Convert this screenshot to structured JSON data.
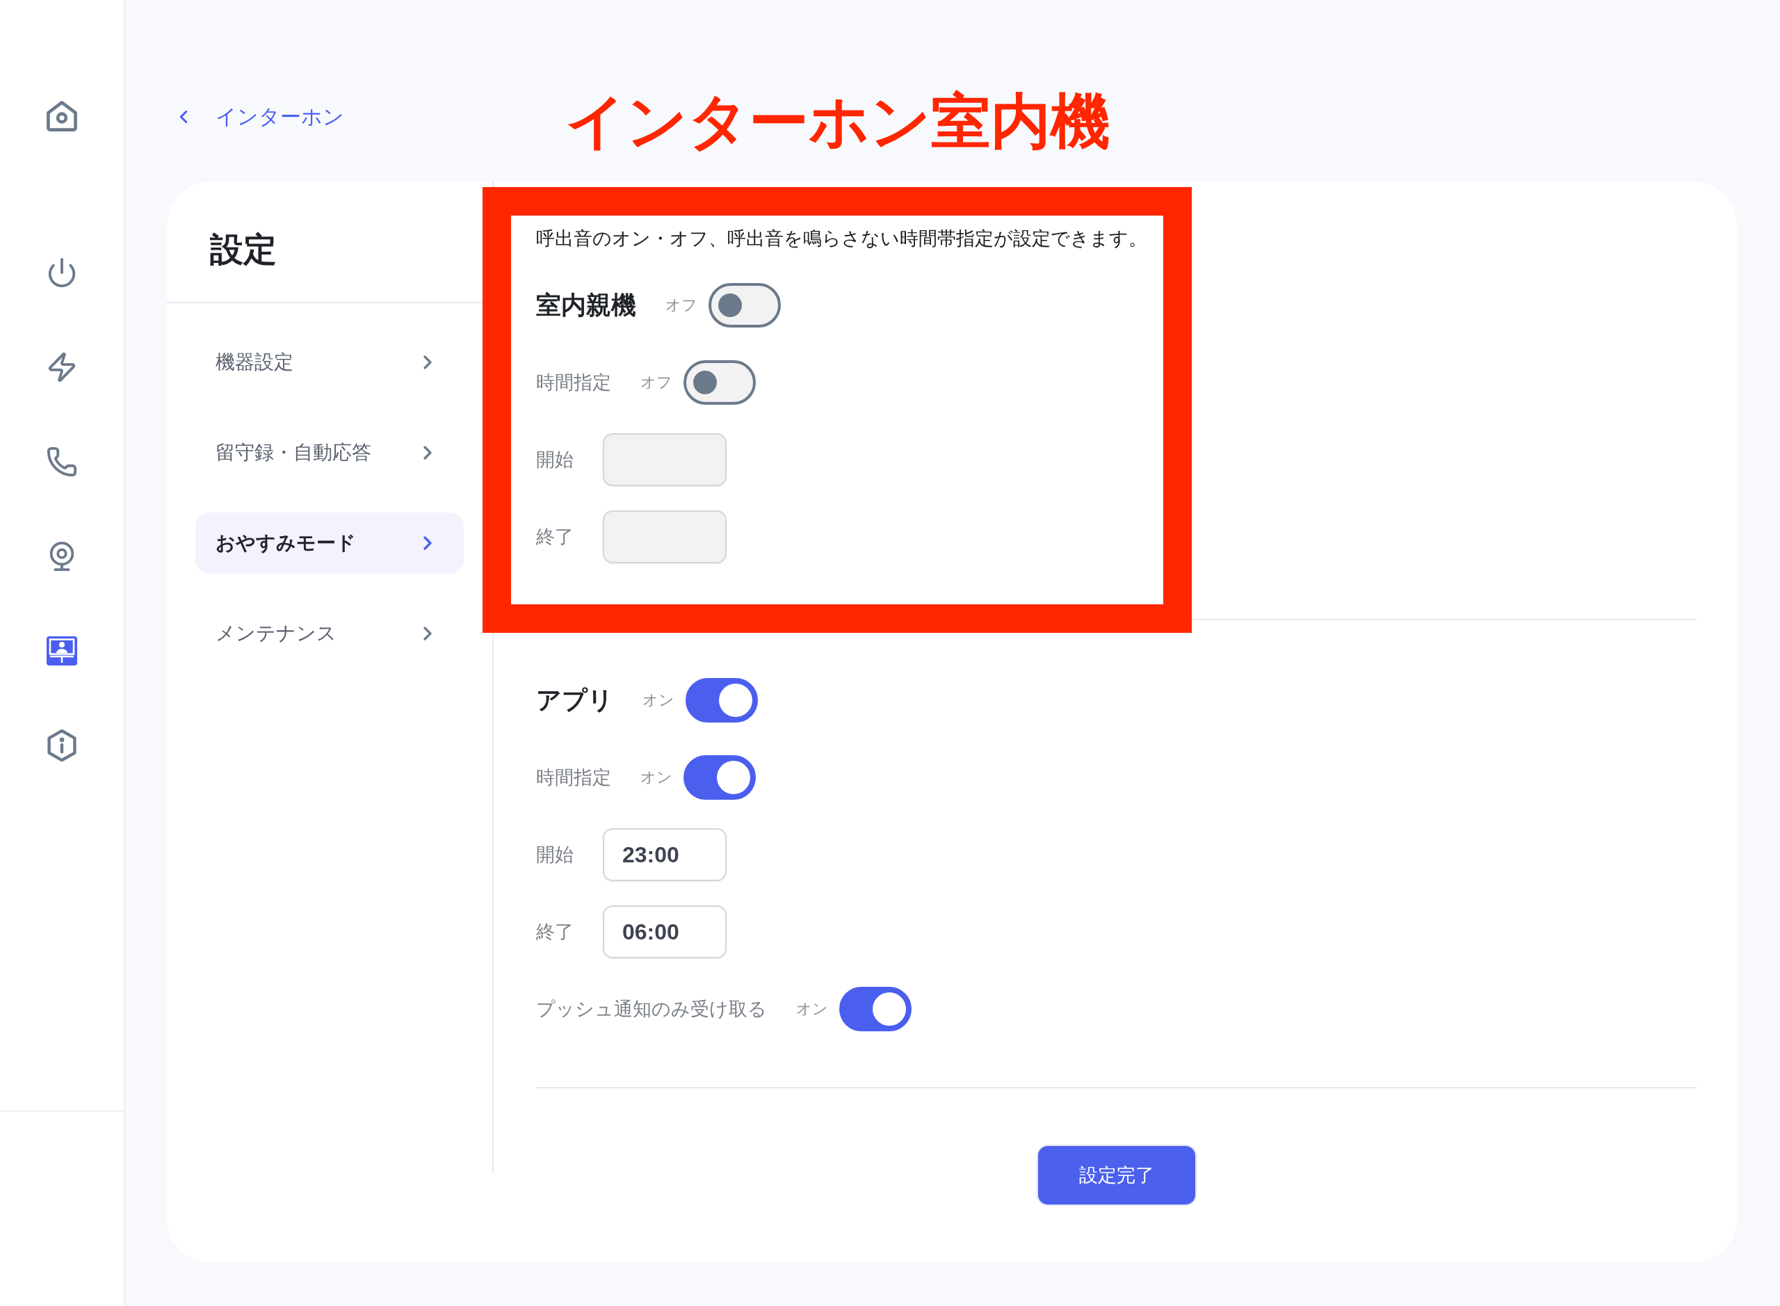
{
  "nav_rail": {
    "items": [
      {
        "selected": false
      },
      {
        "selected": false
      },
      {
        "selected": false
      },
      {
        "selected": false
      },
      {
        "selected": false
      },
      {
        "selected": true
      },
      {
        "selected": false
      }
    ]
  },
  "back_link": {
    "label": "インターホン"
  },
  "annotation": {
    "title": "インターホン室内機"
  },
  "settings": {
    "title": "設定",
    "menu": [
      {
        "label": "機器設定",
        "selected": false
      },
      {
        "label": "留守録・自動応答",
        "selected": false
      },
      {
        "label": "おやすみモード",
        "selected": true
      },
      {
        "label": "メンテナンス",
        "selected": false
      }
    ],
    "description": "呼出音のオン・オフ、呼出音を鳴らさない時間帯指定が設定できます。",
    "sections": [
      {
        "title": "室内親機",
        "state_label": "オフ",
        "on": false,
        "rows": [
          {
            "kind": "toggle",
            "label": "時間指定",
            "state_label": "オフ",
            "on": false
          },
          {
            "kind": "time",
            "label": "開始",
            "disabled": true
          },
          {
            "kind": "time",
            "label": "終了",
            "disabled": true
          }
        ]
      },
      {
        "title": "アプリ",
        "state_label": "オン",
        "on": true,
        "rows": [
          {
            "kind": "toggle",
            "label": "時間指定",
            "state_label": "オン",
            "on": true
          },
          {
            "kind": "time",
            "label": "開始",
            "value": "23:00",
            "disabled": false
          },
          {
            "kind": "time",
            "label": "終了",
            "value": "06:00",
            "disabled": false
          },
          {
            "kind": "toggle",
            "label": "プッシュ通知のみ受け取る",
            "state_label": "オン",
            "on": true
          }
        ]
      }
    ],
    "submit_button": "設定完了"
  }
}
